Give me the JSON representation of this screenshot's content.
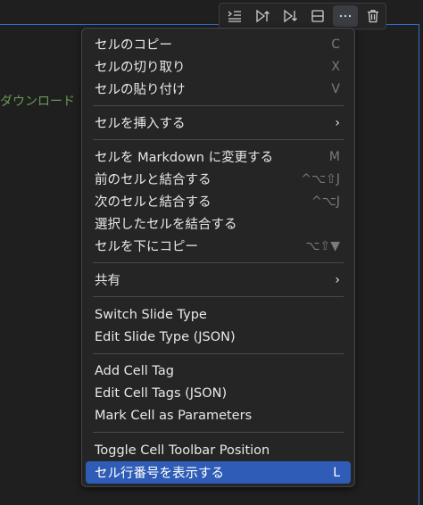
{
  "cell": {
    "text": "ダウンロード"
  },
  "toolbar": {
    "buttons": [
      {
        "name": "execute-above-icon"
      },
      {
        "name": "execute-cell-and-above-icon"
      },
      {
        "name": "execute-cell-and-below-icon"
      },
      {
        "name": "split-cell-icon"
      },
      {
        "name": "more-actions-icon"
      },
      {
        "name": "delete-cell-icon"
      }
    ]
  },
  "menu": {
    "items": [
      {
        "label": "セルのコピー",
        "shortcut": "C"
      },
      {
        "label": "セルの切り取り",
        "shortcut": "X"
      },
      {
        "label": "セルの貼り付け",
        "shortcut": "V"
      },
      {
        "label": "セルを挿入する",
        "submenu": "›"
      },
      {
        "label": "セルを Markdown に変更する",
        "shortcut": "M"
      },
      {
        "label": "前のセルと結合する",
        "shortcut": "^⌥⇧J"
      },
      {
        "label": "次のセルと結合する",
        "shortcut": "^⌥J"
      },
      {
        "label": "選択したセルを結合する",
        "shortcut": ""
      },
      {
        "label": "セルを下にコピー",
        "shortcut": "⌥⇧▼"
      },
      {
        "label": "共有",
        "submenu": "›"
      },
      {
        "label": "Switch Slide Type",
        "shortcut": ""
      },
      {
        "label": "Edit Slide Type (JSON)",
        "shortcut": ""
      },
      {
        "label": "Add Cell Tag",
        "shortcut": ""
      },
      {
        "label": "Edit Cell Tags (JSON)",
        "shortcut": ""
      },
      {
        "label": "Mark Cell as Parameters",
        "shortcut": ""
      },
      {
        "label": "Toggle Cell Toolbar Position",
        "shortcut": ""
      },
      {
        "label": "セル行番号を表示する",
        "shortcut": "L"
      }
    ]
  },
  "colors": {
    "accent": "#2f5cb6",
    "cell_border": "#2f6fd1",
    "markdown_text": "#6a9955"
  }
}
